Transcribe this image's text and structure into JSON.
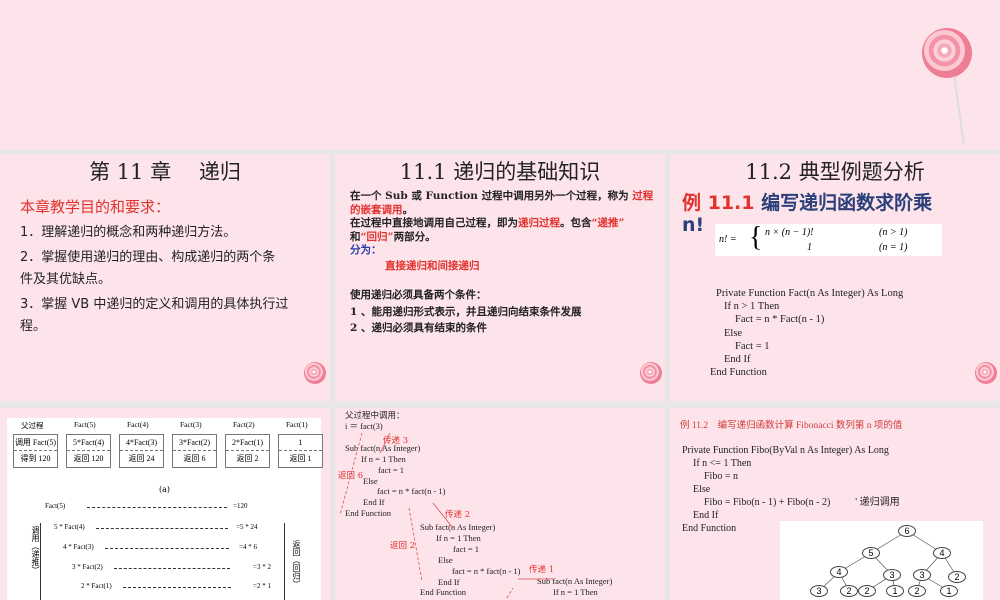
{
  "s1": {
    "title": "第 11 章　 递归",
    "heading": "本章教学目的和要求：",
    "items": [
      "1．理解递归的概念和两种递归方法。",
      "2．掌握使用递归的理由、构成递归的两个条",
      "件及其优缺点。",
      "3．掌握 VB 中递归的定义和调用的具体执行过",
      "程。"
    ]
  },
  "s2": {
    "title": "11.1 递归的基础知识",
    "p1a": "在一个 Sub 或 Function 过程中调用另外一个过程，称为",
    "p1b": "过程",
    "p1c": "的嵌套调用",
    "p2a": "在过程中直接地调用自己过程，即为",
    "p2b": "递归过程",
    "p2c": "。包含",
    "p2d": "“递推”",
    "p3a": "和",
    "p3b": "“回归”",
    "p3c": "两部分。",
    "p4": "分为：",
    "p5": "直接递归和间接递归",
    "p6": "使用递归必须具备两个条件：",
    "p7": "1 、能用递归形式表示，并且递归向结束条件发展",
    "p8": "2 、递归必须具有结束的条件"
  },
  "s3": {
    "title": "11.2 典型例题分析",
    "ex": "例 11.1",
    "ex_text": "编写递归函数求阶乘",
    "ex_text2": "n!",
    "f_lhs": "n! =",
    "f_r1": "n × (n − 1)!",
    "f_c1": "(n > 1)",
    "f_r2": "1",
    "f_c2": "(n = 1)",
    "code": [
      "Private Function Fact(n As Integer) As Long",
      "If n > 1 Then",
      "Fact = n * Fact(n - 1)",
      "Else",
      "Fact = 1",
      "End If",
      "End Function"
    ]
  },
  "s4": {
    "headers": [
      "父过程",
      "Fact(5)",
      "Fact(4)",
      "Fact(3)",
      "Fact(2)",
      "Fact(1)"
    ],
    "calls": [
      "调用 Fact(5)",
      "5*Fact(4)",
      "4*Fact(3)",
      "3*Fact(2)",
      "2*Fact(1)",
      "1"
    ],
    "returns": [
      "得到 120",
      "返回 120",
      "返回 24",
      "返回 6",
      "返回 2",
      "返回 1"
    ],
    "caption": "(a)",
    "left": [
      "Fact(5)",
      "5 * Fact(4)",
      "4 * Fact(3)",
      "3 * Fact(2)",
      "2 * Fact(1)"
    ],
    "right": [
      "=120",
      "=5 * 24",
      "=4 * 6",
      "=3 * 2",
      "=2 * 1"
    ],
    "side_left": "调用（递推）",
    "side_right": "返回（回归）"
  },
  "s5": {
    "lines": [
      "父过程中调用：",
      "i ＝ fact(3)",
      "Sub fact(n As Integer)",
      "If n = 1 Then",
      "fact = 1",
      "Else",
      "fact = n * fact(n - 1)",
      "End If",
      "End Function"
    ],
    "lines2": [
      "Sub fact(n As Integer)",
      "If n = 1 Then",
      "fact = 1",
      "Else",
      "fact = n * fact(n - 1)",
      "End If",
      "End Function"
    ],
    "lines3": [
      "Sub fact(n As Integer)",
      "If n = 1 Then"
    ],
    "pass3": "传递 3",
    "ret6": "返回 6",
    "pass2": "传递 2",
    "ret2": "返回 2",
    "pass1": "传递 1"
  },
  "s6": {
    "title": "例 11.2　编写递归函数计算 Fibonacci 数列第 n 项的值",
    "code": [
      "Private Function Fibo(ByVal n As Integer) As Long",
      "If n <= 1 Then",
      "Fibo = n",
      "Else",
      "Fibo = Fibo(n - 1) + Fibo(n - 2)",
      "End If",
      "End Function"
    ],
    "comment": "' 递归调用",
    "tree": [
      "6",
      "5",
      "4",
      "4",
      "3",
      "3",
      "2",
      "3",
      "2",
      "2",
      "1",
      "2",
      "1"
    ]
  }
}
